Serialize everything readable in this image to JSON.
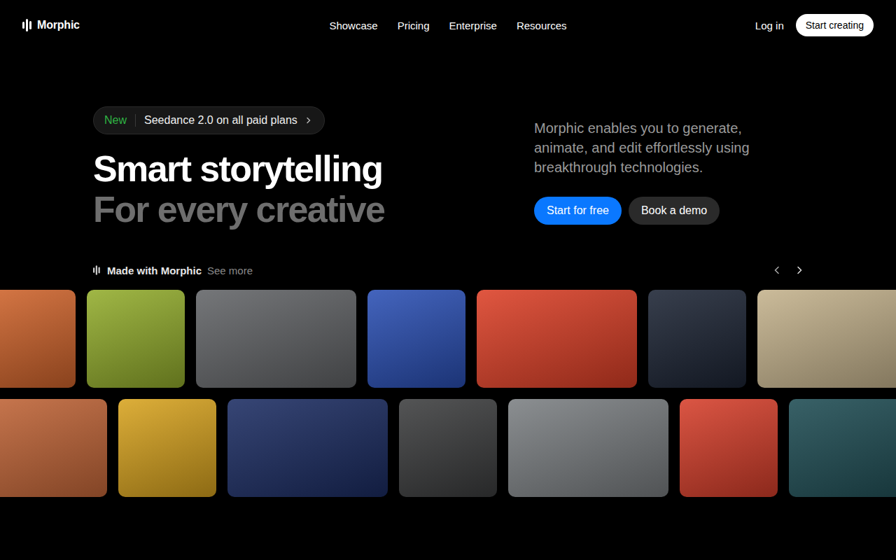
{
  "nav": {
    "brand": "Morphic",
    "links": [
      "Showcase",
      "Pricing",
      "Enterprise",
      "Resources"
    ],
    "login": "Log in",
    "cta": "Start creating"
  },
  "hero": {
    "badge": {
      "tag": "New",
      "text": "Seedance 2.0 on all paid plans"
    },
    "title": "Smart storytelling",
    "subtitle": "For every creative",
    "description": "Morphic enables you to generate, animate, and edit effortlessly using breakthrough technologies.",
    "primary": "Start for free",
    "secondary": "Book a demo"
  },
  "gallery": {
    "title": "Made with Morphic",
    "link": "See more",
    "rows": [
      [
        {
          "kind": "square",
          "color": "#d2652c"
        },
        {
          "kind": "square",
          "color": "#93ad2c"
        },
        {
          "kind": "wide",
          "color": "#626467"
        },
        {
          "kind": "square",
          "color": "#2a4fb4"
        },
        {
          "kind": "wide",
          "color": "#dc3f26"
        },
        {
          "kind": "square",
          "color": "#1c2434"
        },
        {
          "kind": "wide",
          "color": "#c4b28c"
        }
      ],
      [
        {
          "kind": "wide",
          "color": "#c8693a"
        },
        {
          "kind": "square",
          "color": "#d8a31e"
        },
        {
          "kind": "wide",
          "color": "#1b2c62"
        },
        {
          "kind": "square",
          "color": "#3c3d3e"
        },
        {
          "kind": "wide",
          "color": "#7b7f82"
        },
        {
          "kind": "square",
          "color": "#d63e2a"
        },
        {
          "kind": "wide",
          "color": "#1d4b52"
        }
      ]
    ]
  }
}
